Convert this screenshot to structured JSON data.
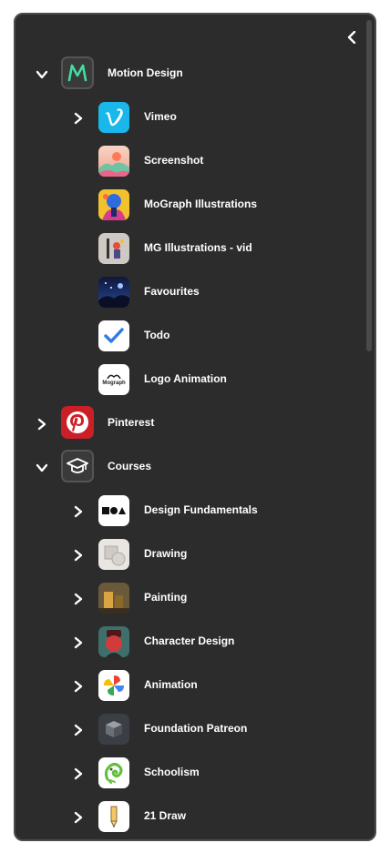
{
  "sidebar": {
    "groups": [
      {
        "label": "Motion Design",
        "items": [
          {
            "label": "Vimeo"
          },
          {
            "label": "Screenshot"
          },
          {
            "label": "MoGraph Illustrations"
          },
          {
            "label": "MG Illustrations - vid"
          },
          {
            "label": "Favourites"
          },
          {
            "label": " Todo"
          },
          {
            "label": "Logo Animation",
            "logo_text": "Mograph"
          }
        ]
      },
      {
        "label": "Pinterest"
      },
      {
        "label": "Courses",
        "items": [
          {
            "label": "Design Fundamentals"
          },
          {
            "label": "Drawing"
          },
          {
            "label": "Painting"
          },
          {
            "label": "Character Design"
          },
          {
            "label": "Animation"
          },
          {
            "label": "Foundation Patreon"
          },
          {
            "label": "Schoolism"
          },
          {
            "label": "21 Draw"
          }
        ]
      }
    ]
  },
  "icons": {
    "collapse": "chevron-left-icon",
    "expanded": "chevron-down-icon",
    "collapsed": "chevron-right-icon"
  },
  "colors": {
    "panel_bg": "#2c2c2c",
    "panel_border": "#4b4b4b",
    "accent_motion": "#3de0a0",
    "vimeo": "#1ab7ea",
    "pinterest": "#cb1f27"
  }
}
